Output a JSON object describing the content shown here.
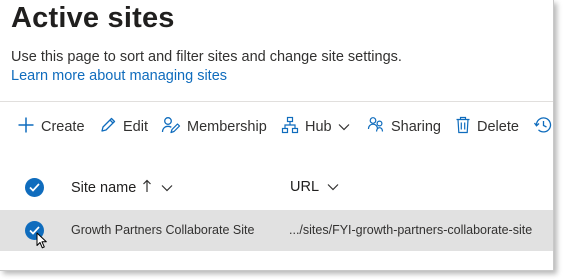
{
  "page": {
    "title": "Active sites",
    "description": "Use this page to sort and filter sites and change site settings.",
    "learn_more": "Learn more about managing sites"
  },
  "toolbar": {
    "create": "Create",
    "edit": "Edit",
    "membership": "Membership",
    "hub": "Hub",
    "sharing": "Sharing",
    "delete": "Delete"
  },
  "table": {
    "columns": {
      "site_name": "Site name",
      "url": "URL"
    },
    "rows": [
      {
        "selected": true,
        "site_name": "Growth Partners Collaborate Site",
        "url": ".../sites/FYI-growth-partners-collaborate-site"
      }
    ]
  },
  "colors": {
    "accent": "#0f6cbd",
    "selected_row": "#e1e1e1"
  },
  "icons": [
    "plus-icon",
    "pencil-icon",
    "membership-icon",
    "hub-icon",
    "chevron-down-icon",
    "sharing-icon",
    "trash-icon",
    "history-icon",
    "sort-ascending-icon",
    "checkmark-icon",
    "mouse-cursor-icon"
  ]
}
